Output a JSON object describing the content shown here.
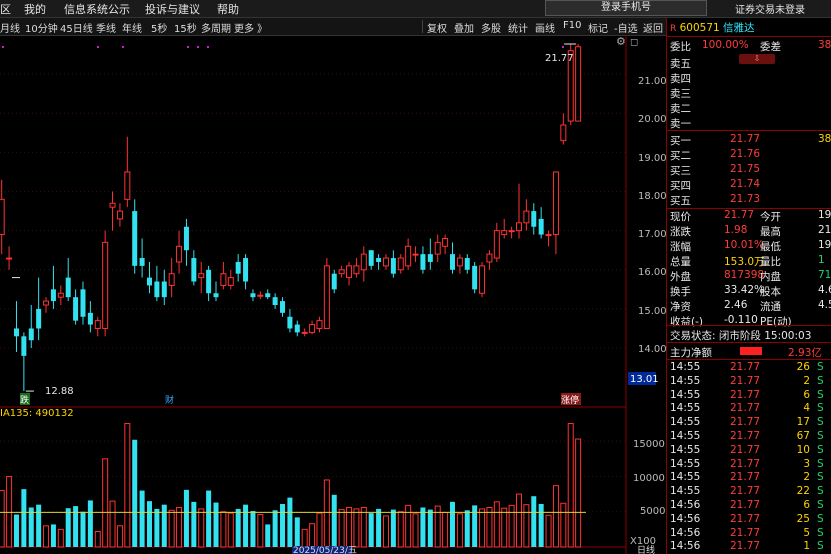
{
  "menubar": {
    "items": [
      "区",
      "我的",
      "信息系统公示",
      "投诉与建议",
      "帮助"
    ],
    "login_button": "登录手机号",
    "trade_status": "证券交易未登录"
  },
  "toolbar": {
    "periods": [
      "月线",
      "10分钟",
      "45日线",
      "季线",
      "年线",
      "5秒",
      "15秒",
      "多周期",
      "更多 》"
    ],
    "tools": [
      "复权",
      "叠加",
      "多股",
      "统计",
      "画线",
      "F10",
      "标记",
      "-自选",
      "返回"
    ]
  },
  "chart": {
    "price_axis": [
      "21.00",
      "20.00",
      "19.00",
      "18.00",
      "17.00",
      "16.00",
      "15.00",
      "14.00"
    ],
    "current_price_tag": "13.01",
    "high_label": "21.77",
    "low_label": "12.88",
    "markers": {
      "die": "跌",
      "cai": "财",
      "zhangting": "涨停"
    },
    "volume_title": "IA135: 490132",
    "volume_axis": [
      "15000",
      "10000",
      "5000",
      "X100"
    ],
    "date_label": "2025/05/23/五",
    "bottom_right_label": "日线"
  },
  "chart_data": {
    "type": "candlestick",
    "price_ylim": [
      12.8,
      22.0
    ],
    "volume_ylim": [
      0,
      18000
    ],
    "volume_ma": 4900,
    "candles": [
      {
        "o": 16.9,
        "c": 17.8,
        "h": 18.3,
        "l": 16.4,
        "v": 8000
      },
      {
        "o": 16.3,
        "c": 16.3,
        "h": 16.6,
        "l": 16.0,
        "v": 10000
      },
      {
        "o": 14.5,
        "c": 14.3,
        "h": 15.2,
        "l": 13.9,
        "v": 4600
      },
      {
        "o": 14.3,
        "c": 13.8,
        "h": 14.4,
        "l": 12.9,
        "v": 8200
      },
      {
        "o": 14.5,
        "c": 14.2,
        "h": 15.1,
        "l": 14.0,
        "v": 5600
      },
      {
        "o": 15.0,
        "c": 14.5,
        "h": 15.8,
        "l": 14.2,
        "v": 6000
      },
      {
        "o": 15.1,
        "c": 15.2,
        "h": 15.3,
        "l": 14.9,
        "v": 3000
      },
      {
        "o": 15.5,
        "c": 15.2,
        "h": 16.1,
        "l": 15.0,
        "v": 3200
      },
      {
        "o": 15.3,
        "c": 15.4,
        "h": 15.6,
        "l": 15.1,
        "v": 2500
      },
      {
        "o": 15.8,
        "c": 15.3,
        "h": 16.3,
        "l": 15.2,
        "v": 5500
      },
      {
        "o": 15.3,
        "c": 14.7,
        "h": 15.5,
        "l": 14.6,
        "v": 5800
      },
      {
        "o": 15.5,
        "c": 14.8,
        "h": 15.7,
        "l": 14.6,
        "v": 5000
      },
      {
        "o": 14.9,
        "c": 14.6,
        "h": 15.2,
        "l": 14.4,
        "v": 6600
      },
      {
        "o": 14.5,
        "c": 14.7,
        "h": 14.8,
        "l": 14.3,
        "v": 2200
      },
      {
        "o": 14.5,
        "c": 16.7,
        "h": 17.0,
        "l": 14.3,
        "v": 12500
      },
      {
        "o": 17.6,
        "c": 17.7,
        "h": 18.0,
        "l": 17.0,
        "v": 6500
      },
      {
        "o": 17.3,
        "c": 17.5,
        "h": 17.7,
        "l": 17.1,
        "v": 3000
      },
      {
        "o": 17.8,
        "c": 18.5,
        "h": 19.4,
        "l": 17.6,
        "v": 17500
      },
      {
        "o": 17.5,
        "c": 16.1,
        "h": 17.8,
        "l": 15.9,
        "v": 15200
      },
      {
        "o": 16.3,
        "c": 16.1,
        "h": 16.8,
        "l": 15.8,
        "v": 8000
      },
      {
        "o": 15.8,
        "c": 15.6,
        "h": 16.2,
        "l": 15.4,
        "v": 6500
      },
      {
        "o": 15.7,
        "c": 15.3,
        "h": 16.1,
        "l": 15.2,
        "v": 5400
      },
      {
        "o": 15.7,
        "c": 15.3,
        "h": 16.0,
        "l": 15.1,
        "v": 6000
      },
      {
        "o": 15.6,
        "c": 15.9,
        "h": 16.3,
        "l": 15.3,
        "v": 5200
      },
      {
        "o": 16.2,
        "c": 16.6,
        "h": 17.0,
        "l": 15.9,
        "v": 5600
      },
      {
        "o": 17.1,
        "c": 16.5,
        "h": 17.3,
        "l": 16.1,
        "v": 8100
      },
      {
        "o": 16.3,
        "c": 15.7,
        "h": 16.5,
        "l": 15.6,
        "v": 6400
      },
      {
        "o": 15.8,
        "c": 15.9,
        "h": 16.2,
        "l": 15.4,
        "v": 5400
      },
      {
        "o": 16.0,
        "c": 15.4,
        "h": 16.1,
        "l": 15.2,
        "v": 8000
      },
      {
        "o": 15.4,
        "c": 15.3,
        "h": 15.7,
        "l": 15.2,
        "v": 6300
      },
      {
        "o": 15.6,
        "c": 15.9,
        "h": 16.2,
        "l": 15.5,
        "v": 5000
      },
      {
        "o": 15.6,
        "c": 15.8,
        "h": 16.0,
        "l": 15.5,
        "v": 4800
      },
      {
        "o": 16.2,
        "c": 15.9,
        "h": 16.4,
        "l": 15.7,
        "v": 5400
      },
      {
        "o": 16.3,
        "c": 15.7,
        "h": 16.4,
        "l": 15.5,
        "v": 6000
      },
      {
        "o": 15.4,
        "c": 15.3,
        "h": 15.5,
        "l": 15.2,
        "v": 5100
      },
      {
        "o": 15.35,
        "c": 15.35,
        "h": 15.45,
        "l": 15.25,
        "v": 4600
      },
      {
        "o": 15.4,
        "c": 15.3,
        "h": 15.5,
        "l": 15.25,
        "v": 3200
      },
      {
        "o": 15.3,
        "c": 15.1,
        "h": 15.4,
        "l": 15.0,
        "v": 5200
      },
      {
        "o": 15.2,
        "c": 14.9,
        "h": 15.3,
        "l": 14.8,
        "v": 6100
      },
      {
        "o": 14.8,
        "c": 14.5,
        "h": 15.0,
        "l": 14.4,
        "v": 7000
      },
      {
        "o": 14.6,
        "c": 14.4,
        "h": 14.7,
        "l": 14.3,
        "v": 4200
      },
      {
        "o": 14.4,
        "c": 14.4,
        "h": 14.5,
        "l": 14.3,
        "v": 2500
      },
      {
        "o": 14.4,
        "c": 14.6,
        "h": 14.7,
        "l": 14.35,
        "v": 3300
      },
      {
        "o": 14.5,
        "c": 14.7,
        "h": 14.8,
        "l": 14.4,
        "v": 4800
      },
      {
        "o": 14.5,
        "c": 16.1,
        "h": 16.3,
        "l": 14.5,
        "v": 9500
      },
      {
        "o": 15.9,
        "c": 15.5,
        "h": 16.0,
        "l": 15.4,
        "v": 7400
      },
      {
        "o": 15.9,
        "c": 16.0,
        "h": 16.1,
        "l": 15.8,
        "v": 5300
      },
      {
        "o": 15.8,
        "c": 16.1,
        "h": 16.2,
        "l": 15.6,
        "v": 5600
      },
      {
        "o": 15.9,
        "c": 16.1,
        "h": 16.3,
        "l": 15.8,
        "v": 5400
      },
      {
        "o": 16.0,
        "c": 16.4,
        "h": 16.6,
        "l": 15.7,
        "v": 5600
      },
      {
        "o": 16.5,
        "c": 16.1,
        "h": 16.5,
        "l": 16.0,
        "v": 4800
      },
      {
        "o": 16.3,
        "c": 16.2,
        "h": 16.4,
        "l": 16.0,
        "v": 5400
      },
      {
        "o": 16.1,
        "c": 16.3,
        "h": 16.4,
        "l": 16.0,
        "v": 4400
      },
      {
        "o": 16.3,
        "c": 15.9,
        "h": 16.5,
        "l": 15.8,
        "v": 5300
      },
      {
        "o": 16.0,
        "c": 16.3,
        "h": 16.4,
        "l": 15.9,
        "v": 5000
      },
      {
        "o": 16.1,
        "c": 16.6,
        "h": 16.8,
        "l": 16.0,
        "v": 5900
      },
      {
        "o": 16.4,
        "c": 16.4,
        "h": 16.6,
        "l": 16.2,
        "v": 4700
      },
      {
        "o": 16.4,
        "c": 16.0,
        "h": 16.6,
        "l": 15.9,
        "v": 5600
      },
      {
        "o": 16.4,
        "c": 16.2,
        "h": 16.8,
        "l": 16.0,
        "v": 5300
      },
      {
        "o": 16.4,
        "c": 16.7,
        "h": 16.9,
        "l": 16.2,
        "v": 5800
      },
      {
        "o": 16.6,
        "c": 16.8,
        "h": 16.9,
        "l": 16.4,
        "v": 4900
      },
      {
        "o": 16.4,
        "c": 16.0,
        "h": 16.7,
        "l": 15.9,
        "v": 6400
      },
      {
        "o": 16.1,
        "c": 16.3,
        "h": 16.4,
        "l": 15.9,
        "v": 4700
      },
      {
        "o": 16.3,
        "c": 16.0,
        "h": 16.4,
        "l": 15.9,
        "v": 5200
      },
      {
        "o": 16.1,
        "c": 15.5,
        "h": 16.2,
        "l": 15.4,
        "v": 5900
      },
      {
        "o": 15.4,
        "c": 16.1,
        "h": 16.2,
        "l": 15.3,
        "v": 5400
      },
      {
        "o": 16.2,
        "c": 16.4,
        "h": 16.5,
        "l": 16.0,
        "v": 5600
      },
      {
        "o": 16.3,
        "c": 17.0,
        "h": 17.2,
        "l": 16.2,
        "v": 6400
      },
      {
        "o": 16.9,
        "c": 17.0,
        "h": 17.3,
        "l": 16.8,
        "v": 5500
      },
      {
        "o": 17.0,
        "c": 17.0,
        "h": 17.1,
        "l": 16.8,
        "v": 5900
      },
      {
        "o": 17.0,
        "c": 17.2,
        "h": 18.2,
        "l": 16.8,
        "v": 7500
      },
      {
        "o": 17.2,
        "c": 17.5,
        "h": 17.8,
        "l": 17.0,
        "v": 6000
      },
      {
        "o": 17.5,
        "c": 17.1,
        "h": 17.7,
        "l": 16.9,
        "v": 7200
      },
      {
        "o": 17.3,
        "c": 16.9,
        "h": 17.6,
        "l": 16.8,
        "v": 6100
      },
      {
        "o": 16.9,
        "c": 16.9,
        "h": 17.0,
        "l": 16.6,
        "v": 4500
      },
      {
        "o": 16.9,
        "c": 18.5,
        "h": 18.5,
        "l": 16.4,
        "v": 8700
      },
      {
        "o": 19.3,
        "c": 19.7,
        "h": 20.0,
        "l": 19.2,
        "v": 6200
      },
      {
        "o": 19.8,
        "c": 21.6,
        "h": 21.77,
        "l": 19.7,
        "v": 17500
      },
      {
        "o": 19.8,
        "c": 21.7,
        "h": 21.77,
        "l": 19.8,
        "v": 15300
      }
    ]
  },
  "quote": {
    "code": "600571",
    "name": "信雅达",
    "weibi_label": "委比",
    "weibi_value": "100.00%",
    "weicha_label": "委差",
    "weicha_value": "38",
    "sell": [
      {
        "label": "卖五",
        "price": "",
        "vol": ""
      },
      {
        "label": "卖四",
        "price": "",
        "vol": ""
      },
      {
        "label": "卖三",
        "price": "",
        "vol": ""
      },
      {
        "label": "卖二",
        "price": "",
        "vol": ""
      },
      {
        "label": "卖一",
        "price": "",
        "vol": ""
      }
    ],
    "buy": [
      {
        "label": "买一",
        "price": "21.77",
        "vol": "380"
      },
      {
        "label": "买二",
        "price": "21.76",
        "vol": ""
      },
      {
        "label": "买三",
        "price": "21.75",
        "vol": ""
      },
      {
        "label": "买四",
        "price": "21.74",
        "vol": ""
      },
      {
        "label": "买五",
        "price": "21.73",
        "vol": ""
      }
    ],
    "stats": [
      {
        "l1": "现价",
        "v1": "21.77",
        "l2": "今开",
        "v2": "19"
      },
      {
        "l1": "涨跌",
        "v1": "1.98",
        "l2": "最高",
        "v2": "21"
      },
      {
        "l1": "涨幅",
        "v1": "10.01%",
        "l2": "最低",
        "v2": "19"
      },
      {
        "l1": "总量",
        "v1": "153.0万",
        "l2": "量比",
        "v2": "1"
      },
      {
        "l1": "外盘",
        "v1": "817398",
        "l2": "内盘",
        "v2": "712"
      },
      {
        "l1": "换手",
        "v1": "33.42%",
        "l2": "股本",
        "v2": "4.6"
      },
      {
        "l1": "净资",
        "v1": "2.46",
        "l2": "流通",
        "v2": "4.5"
      },
      {
        "l1": "收益(-)",
        "v1": "-0.110",
        "l2": "PE(动)",
        "v2": ""
      }
    ],
    "trade_state": "交易状态: 闭市阶段 15:00:03",
    "net_flow_label": "主力净额",
    "net_flow_value": "2.93亿",
    "ticks": [
      {
        "t": "14:55",
        "p": "21.77",
        "v": "26",
        "d": "S"
      },
      {
        "t": "14:55",
        "p": "21.77",
        "v": "2",
        "d": "S"
      },
      {
        "t": "14:55",
        "p": "21.77",
        "v": "6",
        "d": "S"
      },
      {
        "t": "14:55",
        "p": "21.77",
        "v": "4",
        "d": "S"
      },
      {
        "t": "14:55",
        "p": "21.77",
        "v": "17",
        "d": "S"
      },
      {
        "t": "14:55",
        "p": "21.77",
        "v": "67",
        "d": "S"
      },
      {
        "t": "14:55",
        "p": "21.77",
        "v": "10",
        "d": "S"
      },
      {
        "t": "14:55",
        "p": "21.77",
        "v": "3",
        "d": "S"
      },
      {
        "t": "14:55",
        "p": "21.77",
        "v": "2",
        "d": "S"
      },
      {
        "t": "14:55",
        "p": "21.77",
        "v": "22",
        "d": "S"
      },
      {
        "t": "14:56",
        "p": "21.77",
        "v": "6",
        "d": "S"
      },
      {
        "t": "14:56",
        "p": "21.77",
        "v": "25",
        "d": "S"
      },
      {
        "t": "14:56",
        "p": "21.77",
        "v": "5",
        "d": "S"
      },
      {
        "t": "14:56",
        "p": "21.77",
        "v": "1",
        "d": "S"
      },
      {
        "t": "14:56",
        "p": "21.77",
        "v": "10",
        "d": "S"
      }
    ]
  }
}
